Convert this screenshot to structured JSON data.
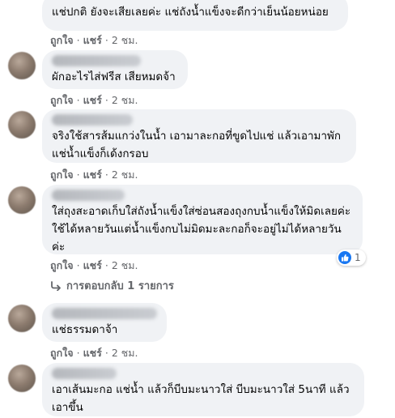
{
  "comments": [
    {
      "author": "",
      "text": "แช่ปกติ ยังจะเสียเลยค่ะ แช่ถังน้ำแข็งจะดีกว่าเย็นน้อยหน่อย",
      "like": "ถูกใจ",
      "share": "แชร์",
      "time": "2 ชม."
    },
    {
      "author": "",
      "text": "ผักอะไรไส่ฟรีส เสียหมดจ้า",
      "like": "ถูกใจ",
      "share": "แชร์",
      "time": "2 ชม."
    },
    {
      "author": "",
      "text": "จริงใช้สารส้มแกว่งในน้ำ เอามาละกอที่ขูดไปแช่ แล้วเอามาพักแช่น้ำแข็งก็เด้งกรอบ",
      "like": "ถูกใจ",
      "share": "แชร์",
      "time": "2 ชม."
    },
    {
      "author": "",
      "text": "ใส่ถุงสะอาดเก็บใส่ถังน้ำแข็งใส่ซ่อนสองถุงกบน้ำแข็งให้มิดเลยค่ะใช้ได้หลายวันแต่น้ำแข็งกบไม่มิดมะละกอก็จะอยู่ไม่ได้หลายวันค่ะ",
      "like": "ถูกใจ",
      "share": "แชร์",
      "time": "2 ชม.",
      "reaction_count": "1"
    },
    {
      "author": "",
      "text": "แช่ธรรมดาจ้า",
      "like": "ถูกใจ",
      "share": "แชร์",
      "time": "2 ชม."
    },
    {
      "author": "",
      "text": "เอาเส้นมะกอ แช่น้ำ แล้วก็บีบมะนาวใส่ บีบมะนาวใส่ 5นาที แล้วเอาขึ้น"
    }
  ],
  "replies_link": "การตอบกลับ 1 รายการ",
  "separator": "·",
  "colors": {
    "bubble": "#f0f2f5",
    "meta": "#65676b",
    "like_blue": "#1877f2"
  }
}
